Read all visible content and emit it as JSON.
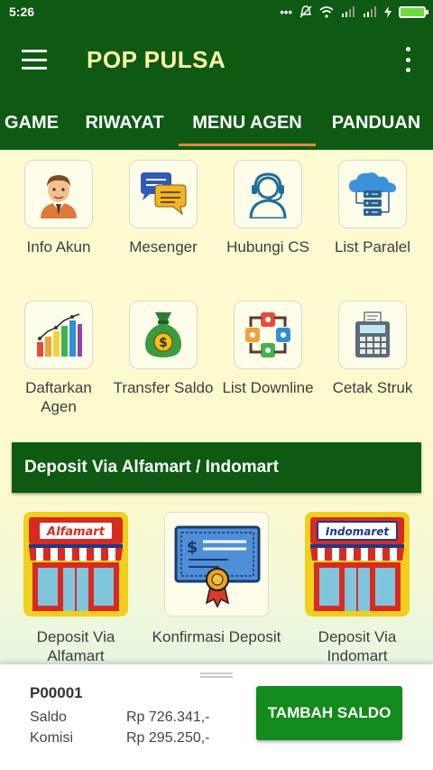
{
  "statusbar": {
    "time": "5:26",
    "dots": "•••"
  },
  "appbar": {
    "title": "POP PULSA"
  },
  "tabs": [
    {
      "label": "GAME"
    },
    {
      "label": "RIWAYAT"
    },
    {
      "label": "MENU AGEN"
    },
    {
      "label": "PANDUAN"
    }
  ],
  "menu": [
    {
      "label": "Info Akun",
      "icon": "user-avatar-icon"
    },
    {
      "label": "Mesenger",
      "icon": "chat-bubbles-icon"
    },
    {
      "label": "Hubungi CS",
      "icon": "customer-service-icon"
    },
    {
      "label": "List Paralel",
      "icon": "cloud-server-icon"
    },
    {
      "label": "Daftarkan Agen",
      "icon": "bar-chart-icon"
    },
    {
      "label": "Transfer Saldo",
      "icon": "money-bag-icon"
    },
    {
      "label": "List Downline",
      "icon": "people-circle-icon"
    },
    {
      "label": "Cetak Struk",
      "icon": "cash-register-icon"
    }
  ],
  "deposit": {
    "title": "Deposit Via Alfamart / Indomart",
    "items": [
      {
        "label": "Deposit Via Alfamart",
        "brand": "Alfamart",
        "icon": "alfamart-store-icon"
      },
      {
        "label": "Konfirmasi Deposit",
        "icon": "certificate-icon"
      },
      {
        "label": "Deposit Via Indomart",
        "brand": "Indomaret",
        "icon": "indomaret-store-icon"
      }
    ]
  },
  "account": {
    "id": "P00001",
    "saldo_label": "Saldo",
    "saldo_value": "Rp 726.341,-",
    "komisi_label": "Komisi",
    "komisi_value": "Rp 295.250,-",
    "topup_label": "TAMBAH SALDO"
  },
  "colors": {
    "primary": "#0e5a12",
    "title": "#fff7a8",
    "tab_indicator": "#e08a3a",
    "button": "#138a1c",
    "background": "#fdfbd0"
  }
}
